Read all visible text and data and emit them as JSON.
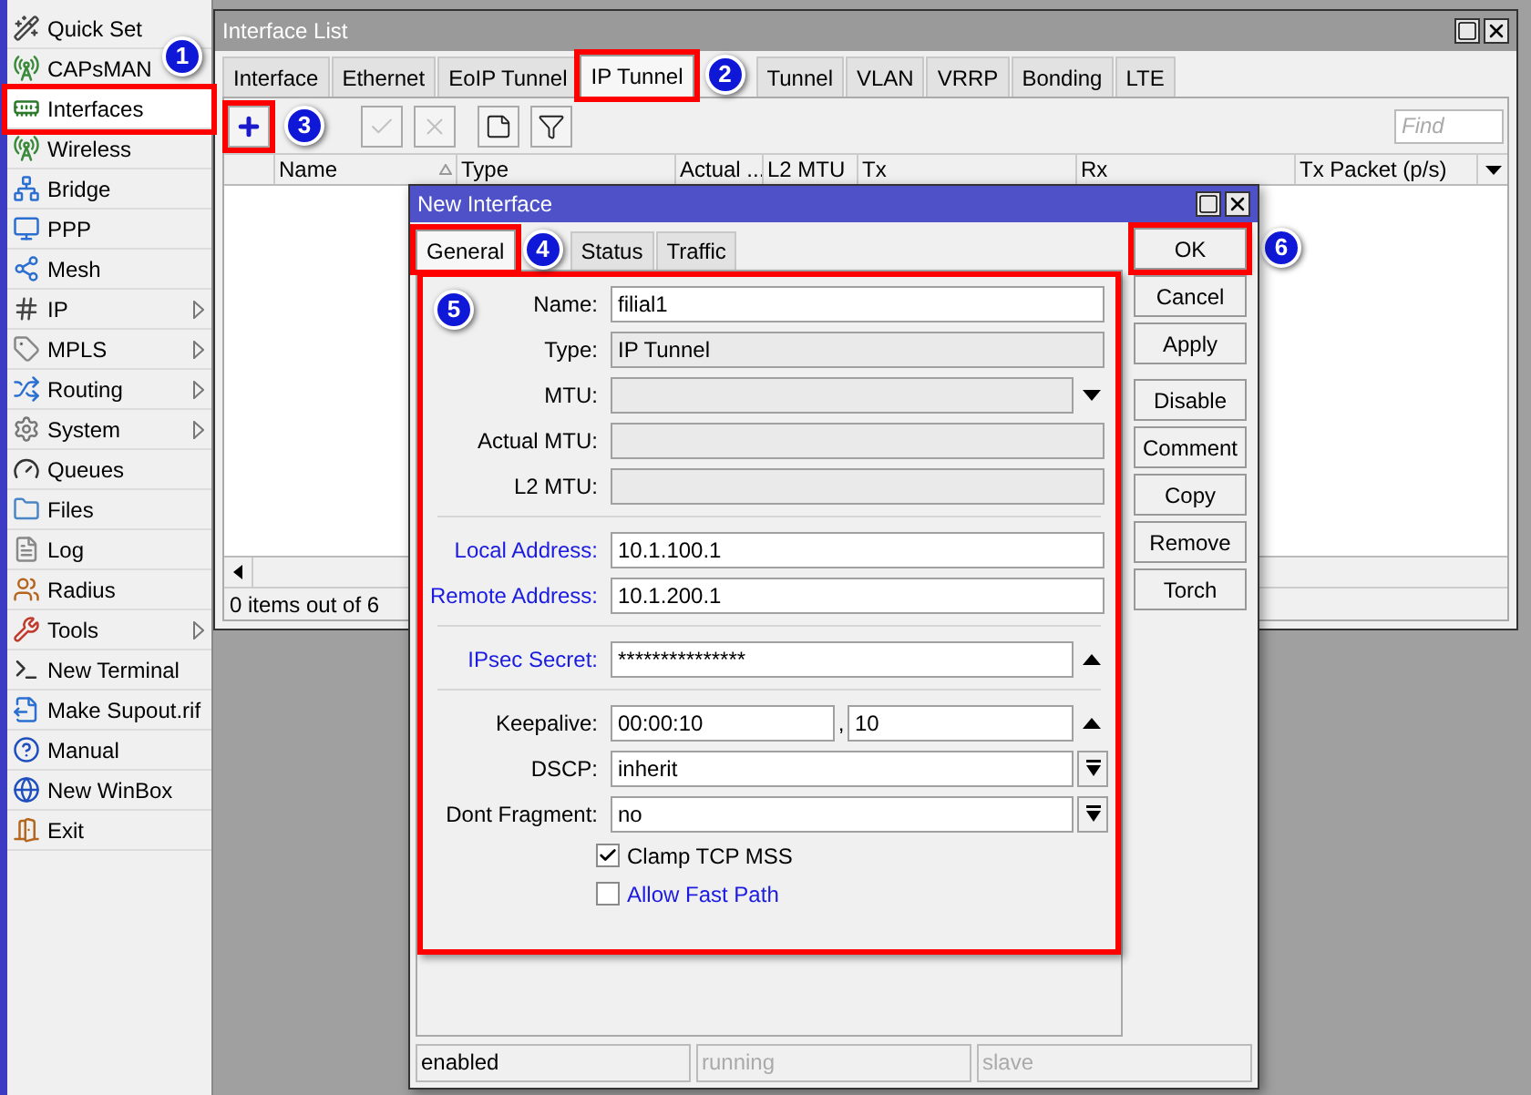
{
  "sidebar": {
    "items": [
      {
        "label": "Quick Set",
        "submenu": false,
        "highlighted": false
      },
      {
        "label": "CAPsMAN",
        "submenu": false,
        "highlighted": false
      },
      {
        "label": "Interfaces",
        "submenu": false,
        "highlighted": true
      },
      {
        "label": "Wireless",
        "submenu": false,
        "highlighted": false
      },
      {
        "label": "Bridge",
        "submenu": false,
        "highlighted": false
      },
      {
        "label": "PPP",
        "submenu": false,
        "highlighted": false
      },
      {
        "label": "Mesh",
        "submenu": false,
        "highlighted": false
      },
      {
        "label": "IP",
        "submenu": true,
        "highlighted": false
      },
      {
        "label": "MPLS",
        "submenu": true,
        "highlighted": false
      },
      {
        "label": "Routing",
        "submenu": true,
        "highlighted": false
      },
      {
        "label": "System",
        "submenu": true,
        "highlighted": false
      },
      {
        "label": "Queues",
        "submenu": false,
        "highlighted": false
      },
      {
        "label": "Files",
        "submenu": false,
        "highlighted": false
      },
      {
        "label": "Log",
        "submenu": false,
        "highlighted": false
      },
      {
        "label": "Radius",
        "submenu": false,
        "highlighted": false
      },
      {
        "label": "Tools",
        "submenu": true,
        "highlighted": false
      },
      {
        "label": "New Terminal",
        "submenu": false,
        "highlighted": false
      },
      {
        "label": "Make Supout.rif",
        "submenu": false,
        "highlighted": false
      },
      {
        "label": "Manual",
        "submenu": false,
        "highlighted": false
      },
      {
        "label": "New WinBox",
        "submenu": false,
        "highlighted": false
      },
      {
        "label": "Exit",
        "submenu": false,
        "highlighted": false
      }
    ]
  },
  "interface_list": {
    "title": "Interface List",
    "tabs": [
      {
        "label": "Interface",
        "selected": false,
        "highlighted": false
      },
      {
        "label": "Ethernet",
        "selected": false,
        "highlighted": false
      },
      {
        "label": "EoIP Tunnel",
        "selected": false,
        "highlighted": false
      },
      {
        "label": "IP Tunnel",
        "selected": true,
        "highlighted": true
      },
      {
        "label": "Tunnel",
        "selected": false,
        "highlighted": false
      },
      {
        "label": "VLAN",
        "selected": false,
        "highlighted": false
      },
      {
        "label": "VRRP",
        "selected": false,
        "highlighted": false
      },
      {
        "label": "Bonding",
        "selected": false,
        "highlighted": false
      },
      {
        "label": "LTE",
        "selected": false,
        "highlighted": false
      }
    ],
    "toolbar": [
      {
        "kind": "add",
        "disabled": false,
        "highlighted": true
      },
      {
        "kind": "enable",
        "disabled": true,
        "highlighted": false
      },
      {
        "kind": "disable",
        "disabled": true,
        "highlighted": false
      },
      {
        "kind": "comment",
        "disabled": false,
        "highlighted": false
      },
      {
        "kind": "filter",
        "disabled": false,
        "highlighted": false
      }
    ],
    "search": {
      "placeholder": "Find"
    },
    "columns": [
      "Name",
      "Type",
      "Actual ...",
      "L2 MTU",
      "Tx",
      "Rx",
      "Tx Packet (p/s)"
    ],
    "status": "0 items out of 6"
  },
  "dialog": {
    "title": "New Interface",
    "tabs": [
      {
        "label": "General",
        "selected": true,
        "highlighted": true
      },
      {
        "label": "Status",
        "selected": false,
        "highlighted": false
      },
      {
        "label": "Traffic",
        "selected": false,
        "highlighted": false
      }
    ],
    "form_highlighted": true,
    "groups": [
      {
        "rows": [
          {
            "kind": "text",
            "label": "Name:",
            "value": "filial1",
            "disabled": false,
            "blue_label": false
          },
          {
            "kind": "text",
            "label": "Type:",
            "value": "IP Tunnel",
            "disabled": true,
            "blue_label": false
          },
          {
            "kind": "dropdown",
            "label": "MTU:",
            "disabled": true,
            "blue_label": false
          },
          {
            "kind": "text",
            "label": "Actual MTU:",
            "disabled": true,
            "blue_label": false
          },
          {
            "kind": "text",
            "label": "L2 MTU:",
            "disabled": true,
            "blue_label": false
          }
        ]
      },
      {
        "rows": [
          {
            "kind": "text",
            "label": "Local Address:",
            "value": "10.1.100.1",
            "disabled": false,
            "blue_label": true
          },
          {
            "kind": "text",
            "label": "Remote Address:",
            "value": "10.1.200.1",
            "disabled": false,
            "blue_label": true
          }
        ]
      },
      {
        "rows": [
          {
            "kind": "spin",
            "label": "IPsec Secret:",
            "value": "***************",
            "disabled": false,
            "blue_label": true
          }
        ]
      },
      {
        "rows": [
          {
            "kind": "pair",
            "label": "Keepalive:",
            "value": "00:00:10",
            "separator": ",",
            "value2": "10",
            "disabled": false,
            "blue_label": false
          },
          {
            "kind": "select",
            "label": "DSCP:",
            "value": "inherit",
            "disabled": false,
            "blue_label": false
          },
          {
            "kind": "select",
            "label": "Dont Fragment:",
            "value": "no",
            "disabled": false,
            "blue_label": false
          },
          {
            "kind": "checkbox",
            "label": "Clamp TCP MSS",
            "checked": true,
            "blue_label": false
          },
          {
            "kind": "checkbox",
            "label": "Allow Fast Path",
            "checked": false,
            "blue_label": true
          }
        ]
      }
    ],
    "button_groups": [
      {
        "buttons": [
          {
            "label": "OK",
            "highlighted": true
          },
          {
            "label": "Cancel",
            "highlighted": false
          },
          {
            "label": "Apply",
            "highlighted": false
          }
        ]
      },
      {
        "buttons": [
          {
            "label": "Disable",
            "highlighted": false
          },
          {
            "label": "Comment",
            "highlighted": false
          },
          {
            "label": "Copy",
            "highlighted": false
          },
          {
            "label": "Remove",
            "highlighted": false
          },
          {
            "label": "Torch",
            "highlighted": false
          }
        ]
      }
    ],
    "status_bar": [
      {
        "label": "enabled",
        "disabled": false
      },
      {
        "label": "running",
        "disabled": true
      },
      {
        "label": "slave",
        "disabled": true
      }
    ]
  },
  "callouts": [
    "1",
    "2",
    "3",
    "4",
    "5",
    "6"
  ]
}
